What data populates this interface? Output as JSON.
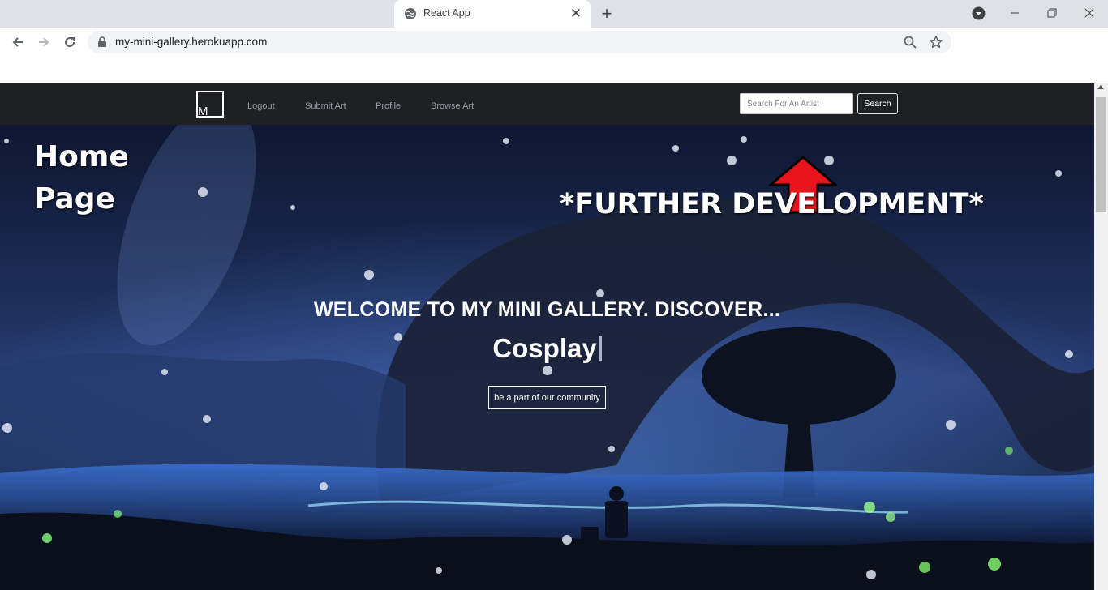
{
  "browser": {
    "tab_title": "React App",
    "url": "my-mini-gallery.herokuapp.com"
  },
  "nav": {
    "brand_letter": "M",
    "links": [
      "Logout",
      "Submit Art",
      "Profile",
      "Browse Art"
    ],
    "search_placeholder": "Search For An Artist",
    "search_button": "Search"
  },
  "hero": {
    "welcome": "WELCOME TO MY MINI GALLERY. DISCOVER...",
    "typed_word": "Cosplay",
    "cta": "be a part of our community"
  },
  "annotations": {
    "home_line1": "Home",
    "home_line2": "Page",
    "further": "*FURTHER DEVELOPMENT*",
    "arrow_color": "#e8141b"
  },
  "colors": {
    "navbar_bg": "#1e2024",
    "chrome_tabstrip": "#dee1e6"
  }
}
